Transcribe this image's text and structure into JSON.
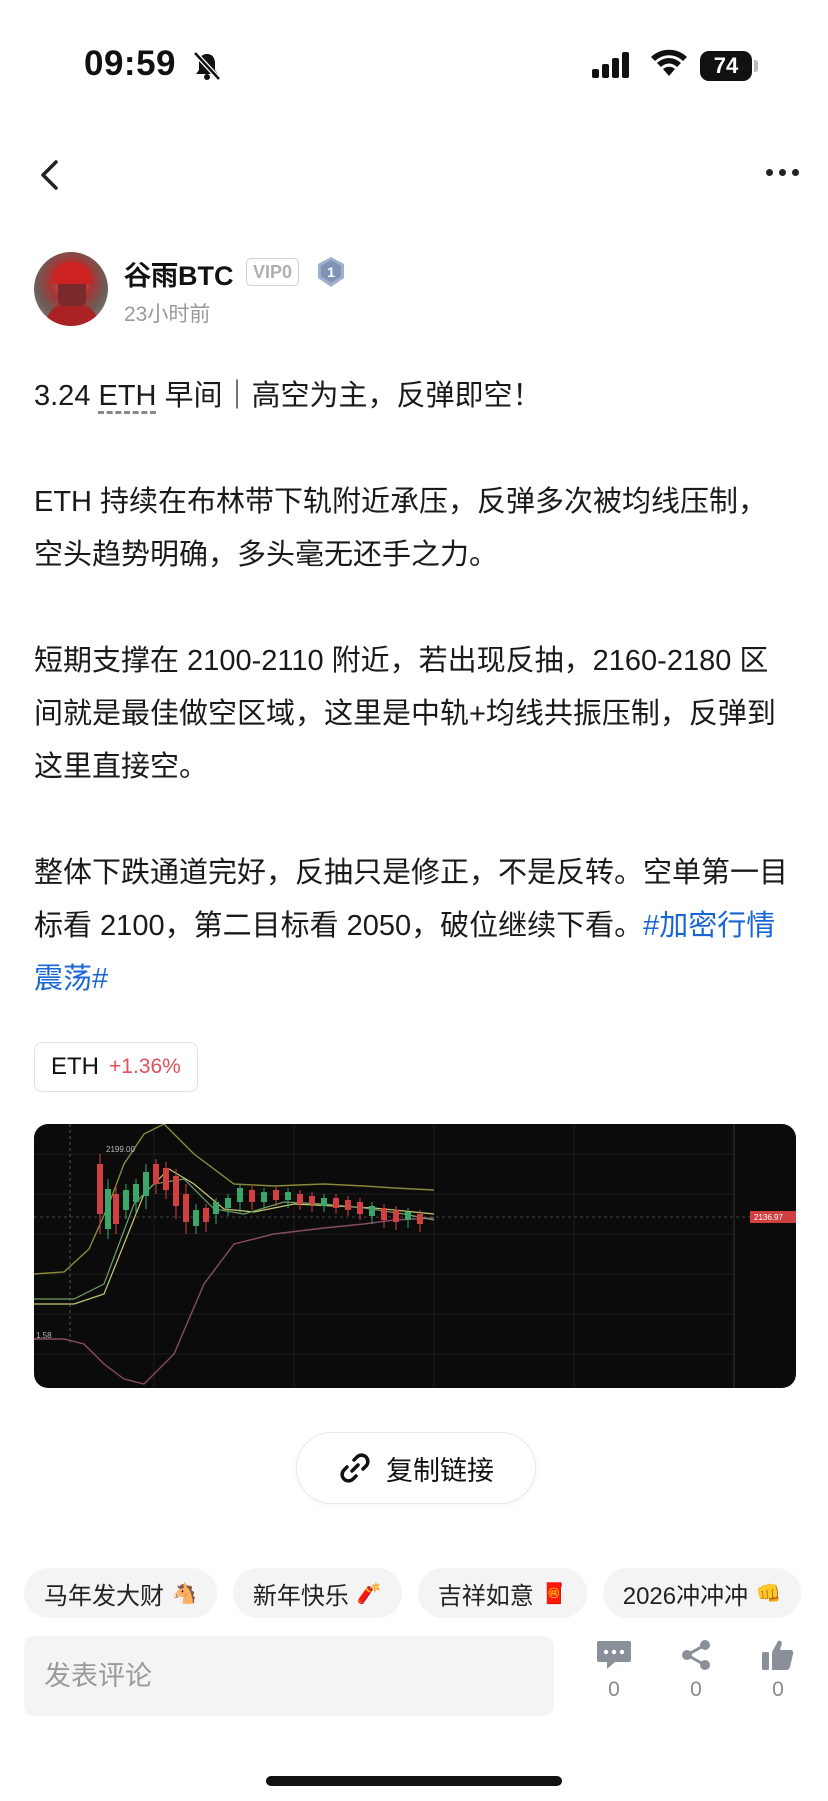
{
  "status_bar": {
    "time": "09:59",
    "battery": "74"
  },
  "author": {
    "name": "谷雨BTC",
    "vip": "VIP0",
    "level": "1",
    "time_ago": "23小时前"
  },
  "post": {
    "title_prefix": "3.24 ",
    "title_eth": "ETH",
    "title_rest": " 早间｜高空为主，反弹即空！",
    "para1": "ETH 持续在布林带下轨附近承压，反弹多次被均线压制，空头趋势明确，多头毫无还手之力。",
    "para2": "短期支撑在 2100-2110 附近，若出现反抽，2160-2180 区间就是最佳做空区域，这里是中轨+均线共振压制，反弹到这里直接空。",
    "para3": "整体下跌通道完好，反抽只是修正，不是反转。空单第一目标看 2100，第二目标看 2050，破位继续下看。",
    "hashtag": "#加密行情震荡#"
  },
  "ticker": {
    "name": "ETH",
    "change": "+1.36%"
  },
  "chart_image": {
    "price_label_top": "2199.00",
    "price_label_current": "2136.97",
    "left_label": "1.58"
  },
  "copy_link": {
    "label": "复制链接"
  },
  "quick_replies": [
    {
      "label": "马年发大财",
      "emoji": "🐴"
    },
    {
      "label": "新年快乐",
      "emoji": "🧨"
    },
    {
      "label": "吉祥如意",
      "emoji": "🧧"
    },
    {
      "label": "2026冲冲冲",
      "emoji": "👊"
    }
  ],
  "comment": {
    "placeholder": "发表评论",
    "comment_count": "0",
    "share_count": "0",
    "like_count": "0"
  }
}
